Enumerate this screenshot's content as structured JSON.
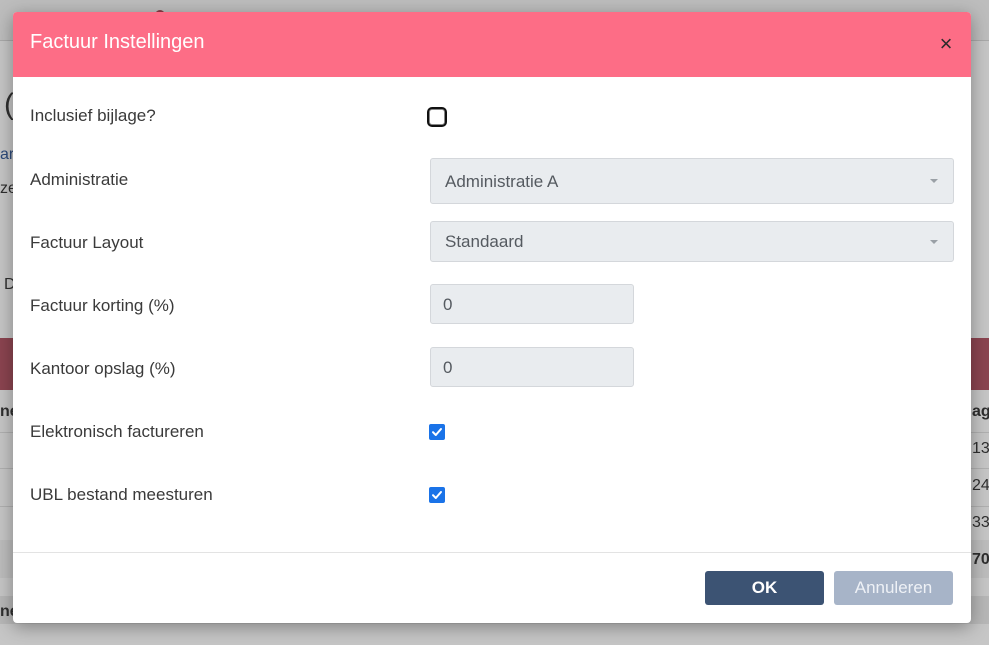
{
  "modal": {
    "title": "Factuur Instellingen",
    "close_symbol": "×",
    "fields": {
      "inclusief_bijlage": {
        "label": "Inclusief bijlage?",
        "checked": false
      },
      "administratie": {
        "label": "Administratie",
        "value": "Administratie A"
      },
      "factuur_layout": {
        "label": "Factuur Layout",
        "value": "Standaard"
      },
      "factuur_korting": {
        "label": "Factuur korting (%)",
        "value": "0"
      },
      "kantoor_opslag": {
        "label": "Kantoor opslag (%)",
        "value": "0"
      },
      "elektronisch_factureren": {
        "label": "Elektronisch factureren",
        "checked": true
      },
      "ubl_bestand": {
        "label": "UBL bestand meesturen",
        "checked": true
      }
    },
    "buttons": {
      "ok": "OK",
      "cancel": "Annuleren"
    }
  },
  "colors": {
    "header": "#fd6d86",
    "primary_button": "#3c5373",
    "secondary_button": "#a7b4c8",
    "checkbox_checked": "#1a73e8"
  }
}
